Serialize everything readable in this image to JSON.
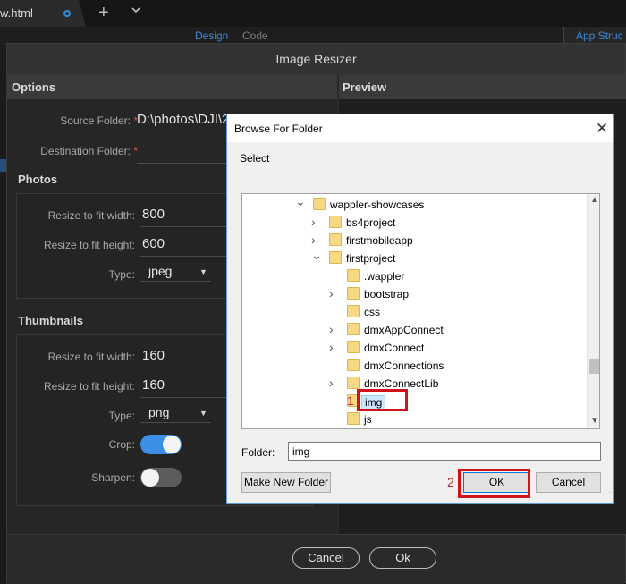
{
  "editor": {
    "file_tab": "w.html",
    "view_design": "Design",
    "view_code": "Code",
    "app_structure": "App Struc"
  },
  "resizer": {
    "title": "Image Resizer",
    "options_header": "Options",
    "preview_header": "Preview",
    "source_label": "Source Folder:",
    "source_value": "D:\\photos\\DJI\\2",
    "dest_label": "Destination Folder:",
    "required_mark": "*",
    "photos": {
      "title": "Photos",
      "width_label": "Resize to fit width:",
      "width_value": "800",
      "height_label": "Resize to fit height:",
      "height_value": "600",
      "type_label": "Type:",
      "type_value": "jpeg"
    },
    "thumbnails": {
      "title": "Thumbnails",
      "width_label": "Resize to fit width:",
      "width_value": "160",
      "height_label": "Resize to fit height:",
      "height_value": "160",
      "type_label": "Type:",
      "type_value": "png",
      "crop_label": "Crop:",
      "crop_on": true,
      "sharpen_label": "Sharpen:",
      "sharpen_on": false
    },
    "cancel_label": "Cancel",
    "ok_label": "Ok",
    "accent_color": "#3d8ee5"
  },
  "browse": {
    "title": "Browse For Folder",
    "close_glyph": "✕",
    "select_label": "Select",
    "tree": [
      {
        "name": "wappler-showcases",
        "level": 0,
        "expanded": true
      },
      {
        "name": "bs4project",
        "level": 1,
        "expanded": false
      },
      {
        "name": "firstmobileapp",
        "level": 1,
        "expanded": false
      },
      {
        "name": "firstproject",
        "level": 1,
        "expanded": true
      },
      {
        "name": ".wappler",
        "level": 2,
        "expanded": null
      },
      {
        "name": "bootstrap",
        "level": 2,
        "expanded": false
      },
      {
        "name": "css",
        "level": 2,
        "expanded": null
      },
      {
        "name": "dmxAppConnect",
        "level": 2,
        "expanded": false
      },
      {
        "name": "dmxConnect",
        "level": 2,
        "expanded": false
      },
      {
        "name": "dmxConnections",
        "level": 2,
        "expanded": null
      },
      {
        "name": "dmxConnectLib",
        "level": 2,
        "expanded": false
      },
      {
        "name": "img",
        "level": 2,
        "expanded": null,
        "selected": true
      },
      {
        "name": "js",
        "level": 2,
        "expanded": null
      }
    ],
    "folder_label": "Folder:",
    "folder_value": "img",
    "new_folder_label": "Make New Folder",
    "ok_label": "OK",
    "cancel_label": "Cancel"
  },
  "annotations": {
    "step1": "1",
    "step2": "2",
    "highlight_color": "#d0121a"
  }
}
